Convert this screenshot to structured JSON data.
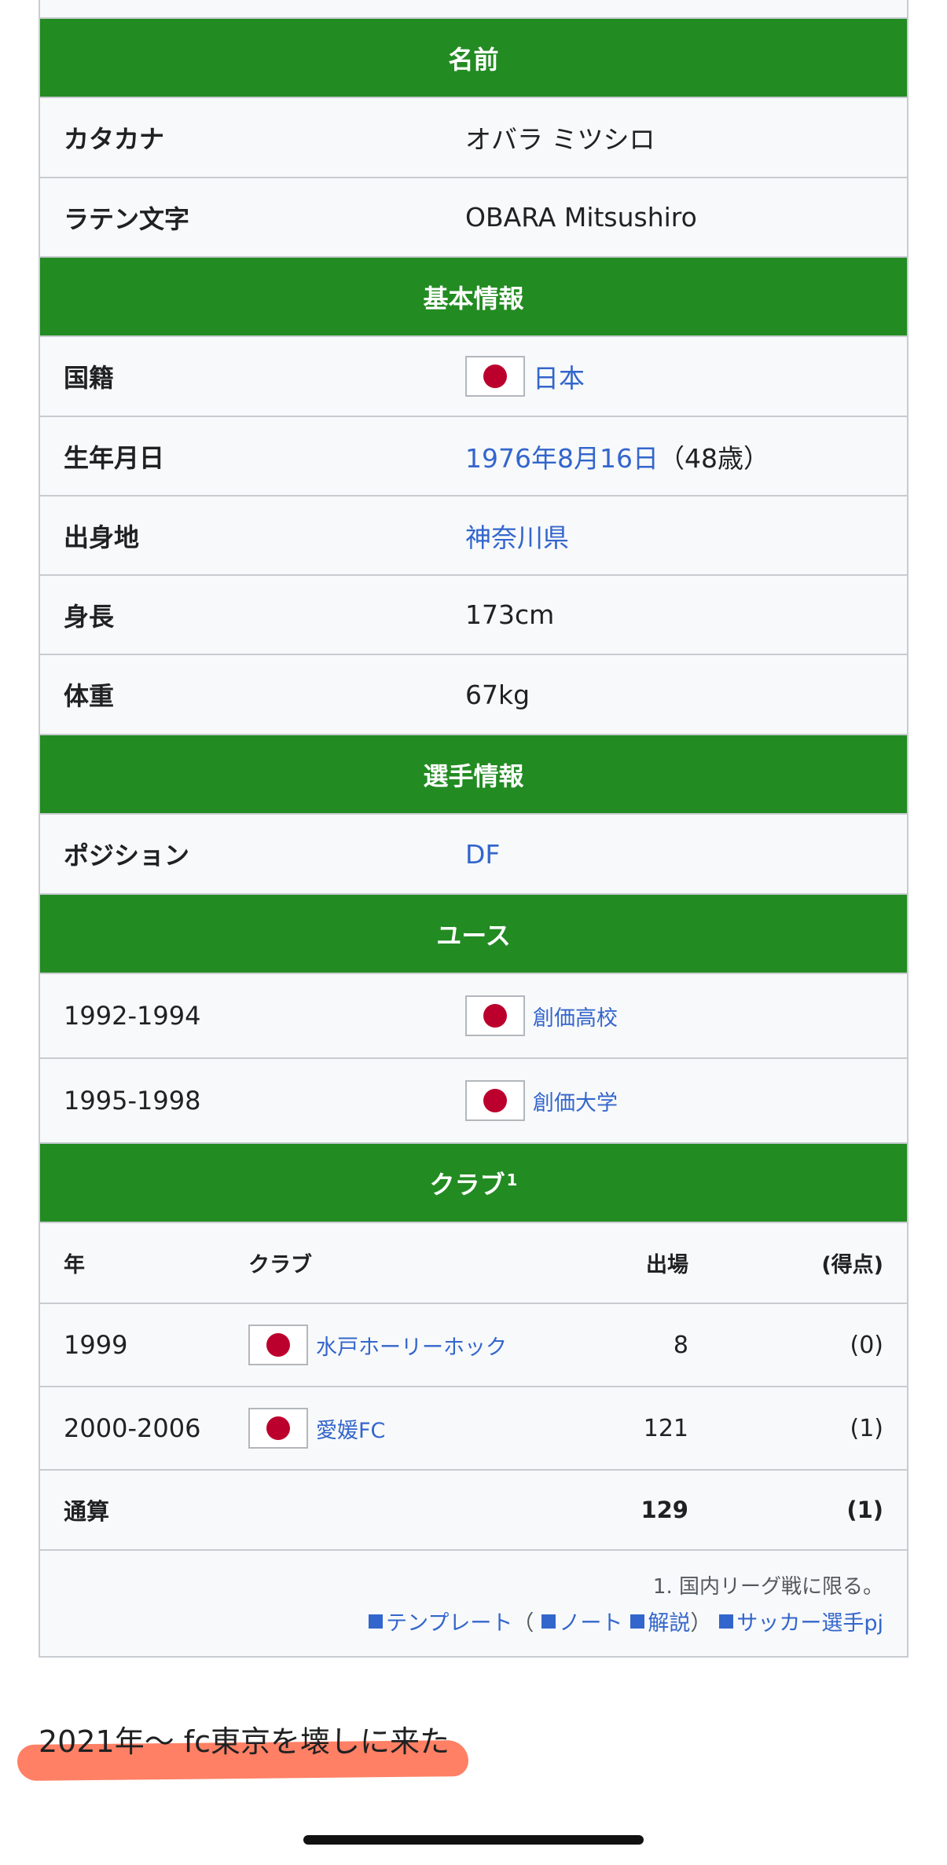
{
  "name_section": {
    "header": "名前",
    "katakana_label": "カタカナ",
    "katakana_value": "オバラ ミツシロ",
    "latin_label": "ラテン文字",
    "latin_value": "OBARA Mitsushiro"
  },
  "basic_section": {
    "header": "基本情報",
    "nationality_label": "国籍",
    "nationality_value": "日本",
    "birth_label": "生年月日",
    "birth_link": "1976年8月16日",
    "birth_age": "（48歳）",
    "birthplace_label": "出身地",
    "birthplace_value": "神奈川県",
    "height_label": "身長",
    "height_value": "173cm",
    "weight_label": "体重",
    "weight_value": "67kg"
  },
  "player_section": {
    "header": "選手情報",
    "position_label": "ポジション",
    "position_value": "DF"
  },
  "youth_section": {
    "header": "ユース",
    "rows": [
      {
        "years": "1992-1994",
        "team": "創価高校"
      },
      {
        "years": "1995-1998",
        "team": "創価大学"
      }
    ]
  },
  "club_section": {
    "header": "クラブ",
    "header_note": "1",
    "columns": {
      "year": "年",
      "club": "クラブ",
      "apps": "出場",
      "goals": "(得点)"
    },
    "rows": [
      {
        "year": "1999",
        "club": "水戸ホーリーホック",
        "apps": "8",
        "goals": "(0)"
      },
      {
        "year": "2000-2006",
        "club": "愛媛FC",
        "apps": "121",
        "goals": "(1)"
      }
    ],
    "total": {
      "label": "通算",
      "apps": "129",
      "goals": "(1)"
    },
    "footnote": "1. 国内リーグ戦に限る。",
    "nav": {
      "template": "テンプレート",
      "open_paren": "（",
      "note": "ノート",
      "explanation": "解説",
      "close_paren": "）",
      "project": "サッカー選手pj"
    }
  },
  "caption": "2021年〜 fc東京を壊しに来た",
  "colors": {
    "header_green": "#228b22",
    "link_blue": "#3366cc",
    "highlight": "#ff6a4a",
    "flag_red": "#bc002d"
  }
}
